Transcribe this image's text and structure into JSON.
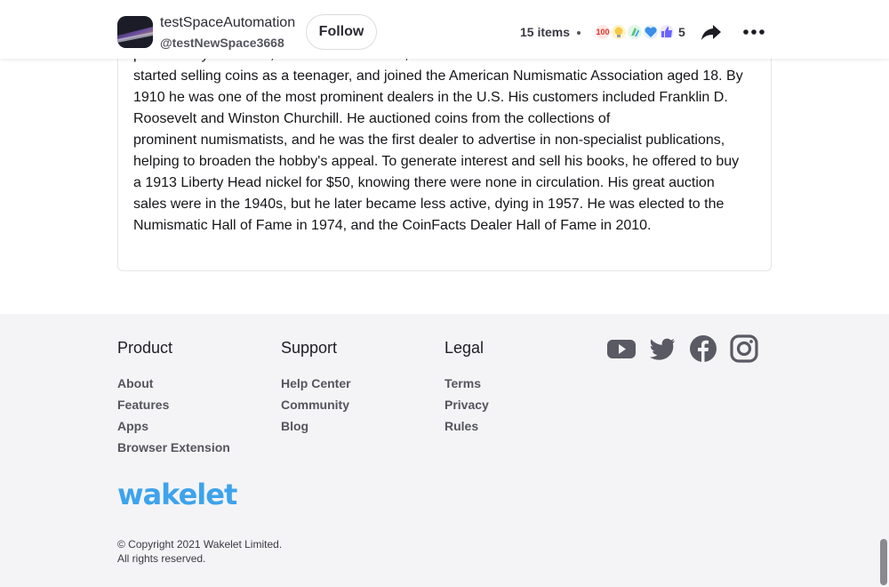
{
  "header": {
    "owner_name": "testSpaceAutomation",
    "owner_handle": "@testNewSpace3668",
    "follow_label": "Follow",
    "items_count": "15 items",
    "reaction_count": "5",
    "reactions": [
      "100-icon",
      "lightbulb-icon",
      "clap-icon",
      "heart-icon",
      "thumbs-up-icon"
    ]
  },
  "article": {
    "lines": [
      "present-day Lithuania, and then to the U.S.; Mehl lived in Fort Worth for most of his life. He",
      "started selling coins as a teenager, and joined the American Numismatic Association aged 18. By",
      "1910 he was one of the most prominent dealers in the U.S. His customers included Franklin D.",
      "Roosevelt and Winston Churchill. He auctioned coins from the collections of",
      "prominent numismatists, and he was the first dealer to advertise in non-specialist publications,",
      "helping to broaden the hobby's appeal. To generate interest and sell his books, he offered to buy",
      "a 1913 Liberty Head nickel for $50, knowing there were none in circulation. His great auction",
      "sales were in the 1940s, but he later became less active, dying in 1957. He was elected to the",
      "Numismatic Hall of Fame in 1974, and the CoinFacts Dealer Hall of Fame in 2010."
    ]
  },
  "footer": {
    "product": {
      "heading": "Product",
      "links": [
        "About",
        "Features",
        "Apps",
        "Browser Extension"
      ]
    },
    "support": {
      "heading": "Support",
      "links": [
        "Help Center",
        "Community",
        "Blog"
      ]
    },
    "legal": {
      "heading": "Legal",
      "links": [
        "Terms",
        "Privacy",
        "Rules"
      ]
    },
    "socials": [
      "youtube-icon",
      "twitter-icon",
      "facebook-icon",
      "instagram-icon"
    ],
    "logo_text": "wakelet",
    "copyright_line1": "© Copyright 2021 Wakelet Limited.",
    "copyright_line2": "All rights reserved."
  },
  "colors": {
    "brand_blue": "#3ea3ec",
    "footer_bg": "#f4f4f6",
    "text_dark": "#16161a"
  }
}
